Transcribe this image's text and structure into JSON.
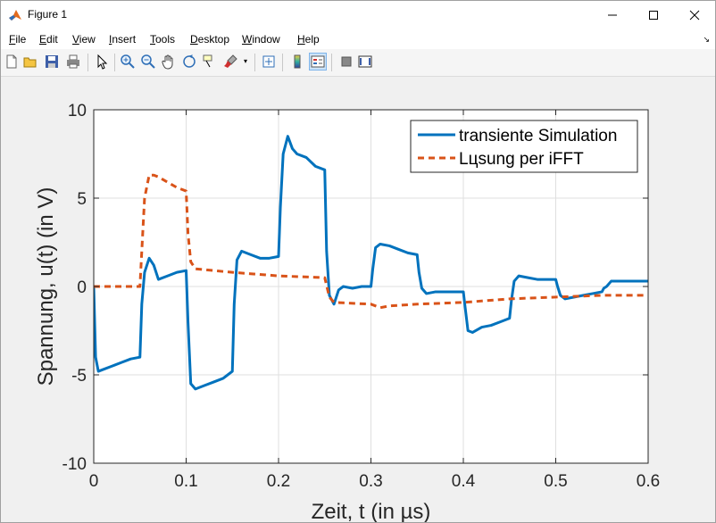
{
  "window": {
    "title": "Figure 1",
    "minimize_glyph": "—",
    "maximize_glyph": "☐",
    "close_glyph": "✕"
  },
  "menu": {
    "items": [
      "File",
      "Edit",
      "View",
      "Insert",
      "Tools",
      "Desktop",
      "Window",
      "Help"
    ]
  },
  "toolbar": {
    "icons": [
      "new-figure-icon",
      "open-file-icon",
      "save-icon",
      "print-icon",
      "pointer-icon",
      "zoom-in-icon",
      "zoom-out-icon",
      "pan-icon",
      "rotate-3d-icon",
      "data-cursor-icon",
      "brush-icon",
      "link-plot-icon",
      "colorbar-icon",
      "legend-icon",
      "hide-plot-tools-icon",
      "show-plot-tools-icon"
    ]
  },
  "chart_data": {
    "type": "line",
    "xlabel": "Zeit, t (in µs)",
    "ylabel": "Spannung, u(t) (in V)",
    "xlim": [
      0,
      0.6
    ],
    "ylim": [
      -10,
      10
    ],
    "xticks": [
      0,
      0.1,
      0.2,
      0.3,
      0.4,
      0.5,
      0.6
    ],
    "xtick_labels": [
      "0",
      "0.1",
      "0.2",
      "0.3",
      "0.4",
      "0.5",
      "0.6"
    ],
    "yticks": [
      -10,
      -5,
      0,
      5,
      10
    ],
    "ytick_labels": [
      "-10",
      "-5",
      "0",
      "5",
      "10"
    ],
    "grid": true,
    "legend_position": "top-right",
    "series": [
      {
        "name": "transiente Simulation",
        "color": "#0072bd",
        "style": "solid",
        "x": [
          0,
          0.002,
          0.005,
          0.01,
          0.02,
          0.03,
          0.04,
          0.05,
          0.052,
          0.055,
          0.06,
          0.065,
          0.07,
          0.08,
          0.09,
          0.1,
          0.102,
          0.105,
          0.11,
          0.12,
          0.13,
          0.14,
          0.15,
          0.152,
          0.155,
          0.16,
          0.17,
          0.18,
          0.19,
          0.2,
          0.202,
          0.205,
          0.21,
          0.215,
          0.22,
          0.23,
          0.24,
          0.25,
          0.252,
          0.255,
          0.26,
          0.265,
          0.27,
          0.28,
          0.29,
          0.3,
          0.302,
          0.305,
          0.31,
          0.32,
          0.33,
          0.34,
          0.35,
          0.352,
          0.355,
          0.36,
          0.37,
          0.38,
          0.39,
          0.4,
          0.402,
          0.405,
          0.41,
          0.42,
          0.43,
          0.44,
          0.45,
          0.452,
          0.455,
          0.46,
          0.47,
          0.48,
          0.49,
          0.5,
          0.502,
          0.505,
          0.51,
          0.52,
          0.53,
          0.54,
          0.55,
          0.552,
          0.555,
          0.56,
          0.57,
          0.58,
          0.59,
          0.6
        ],
        "values": [
          0,
          -4.0,
          -4.8,
          -4.7,
          -4.5,
          -4.3,
          -4.1,
          -4.0,
          -1.0,
          0.8,
          1.6,
          1.2,
          0.4,
          0.6,
          0.8,
          0.9,
          -2.0,
          -5.5,
          -5.8,
          -5.6,
          -5.4,
          -5.2,
          -4.8,
          -1.0,
          1.5,
          2.0,
          1.8,
          1.6,
          1.6,
          1.7,
          4.5,
          7.5,
          8.5,
          7.8,
          7.5,
          7.3,
          6.8,
          6.6,
          2.0,
          -0.5,
          -1.0,
          -0.2,
          0.0,
          -0.1,
          0.0,
          0.0,
          1.0,
          2.2,
          2.4,
          2.3,
          2.1,
          1.9,
          1.8,
          0.8,
          -0.1,
          -0.4,
          -0.3,
          -0.3,
          -0.3,
          -0.3,
          -1.2,
          -2.5,
          -2.6,
          -2.3,
          -2.2,
          -2.0,
          -1.8,
          -0.8,
          0.3,
          0.6,
          0.5,
          0.4,
          0.4,
          0.4,
          0.0,
          -0.5,
          -0.7,
          -0.6,
          -0.5,
          -0.4,
          -0.3,
          -0.1,
          0.0,
          0.3,
          0.3,
          0.3,
          0.3,
          0.3
        ]
      },
      {
        "name": "Lцsung per iFFT",
        "color": "#d95319",
        "style": "dashed",
        "x": [
          0,
          0.05,
          0.052,
          0.055,
          0.06,
          0.065,
          0.07,
          0.08,
          0.09,
          0.1,
          0.102,
          0.105,
          0.11,
          0.15,
          0.2,
          0.25,
          0.255,
          0.26,
          0.3,
          0.31,
          0.32,
          0.35,
          0.4,
          0.45,
          0.5,
          0.55,
          0.6
        ],
        "values": [
          0,
          0,
          2.0,
          5.0,
          6.3,
          6.3,
          6.2,
          5.9,
          5.6,
          5.4,
          3.0,
          1.4,
          1.0,
          0.8,
          0.6,
          0.5,
          -0.6,
          -0.9,
          -1.0,
          -1.2,
          -1.1,
          -1.0,
          -0.9,
          -0.7,
          -0.6,
          -0.5,
          -0.5
        ]
      }
    ]
  }
}
